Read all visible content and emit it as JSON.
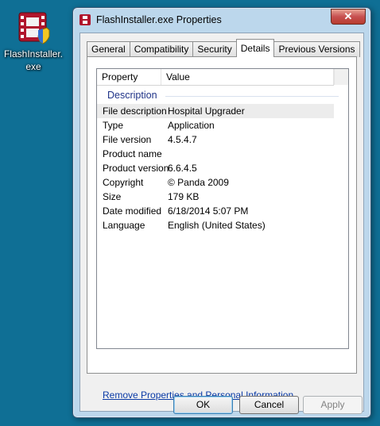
{
  "desktop": {
    "icon_label": "FlashInstaller.\nexe",
    "icon_label_line1": "FlashInstaller.",
    "icon_label_line2": "exe",
    "icon": "film-strip-shield-icon"
  },
  "window": {
    "title": "FlashInstaller.exe Properties",
    "close_label": "✕",
    "icon": "film-strip-icon"
  },
  "tabs": [
    {
      "label": "General"
    },
    {
      "label": "Compatibility"
    },
    {
      "label": "Security"
    },
    {
      "label": "Details",
      "active": true
    },
    {
      "label": "Previous Versions"
    }
  ],
  "details": {
    "col_property": "Property",
    "col_value": "Value",
    "group": "Description",
    "rows": [
      {
        "key": "File description",
        "value": "Hospital Upgrader"
      },
      {
        "key": "Type",
        "value": "Application"
      },
      {
        "key": "File version",
        "value": "4.5.4.7"
      },
      {
        "key": "Product name",
        "value": ""
      },
      {
        "key": "Product version",
        "value": "6.6.4.5"
      },
      {
        "key": "Copyright",
        "value": "© Panda 2009"
      },
      {
        "key": "Size",
        "value": "179 KB"
      },
      {
        "key": "Date modified",
        "value": "6/18/2014 5:07 PM"
      },
      {
        "key": "Language",
        "value": "English (United States)"
      }
    ]
  },
  "link": "Remove Properties and Personal Information",
  "buttons": {
    "ok": "OK",
    "cancel": "Cancel",
    "apply": "Apply"
  },
  "colors": {
    "desktop": "#0f6f95",
    "link": "#0a3aa6",
    "group_header": "#1e3287",
    "close_button": "#c75050"
  }
}
